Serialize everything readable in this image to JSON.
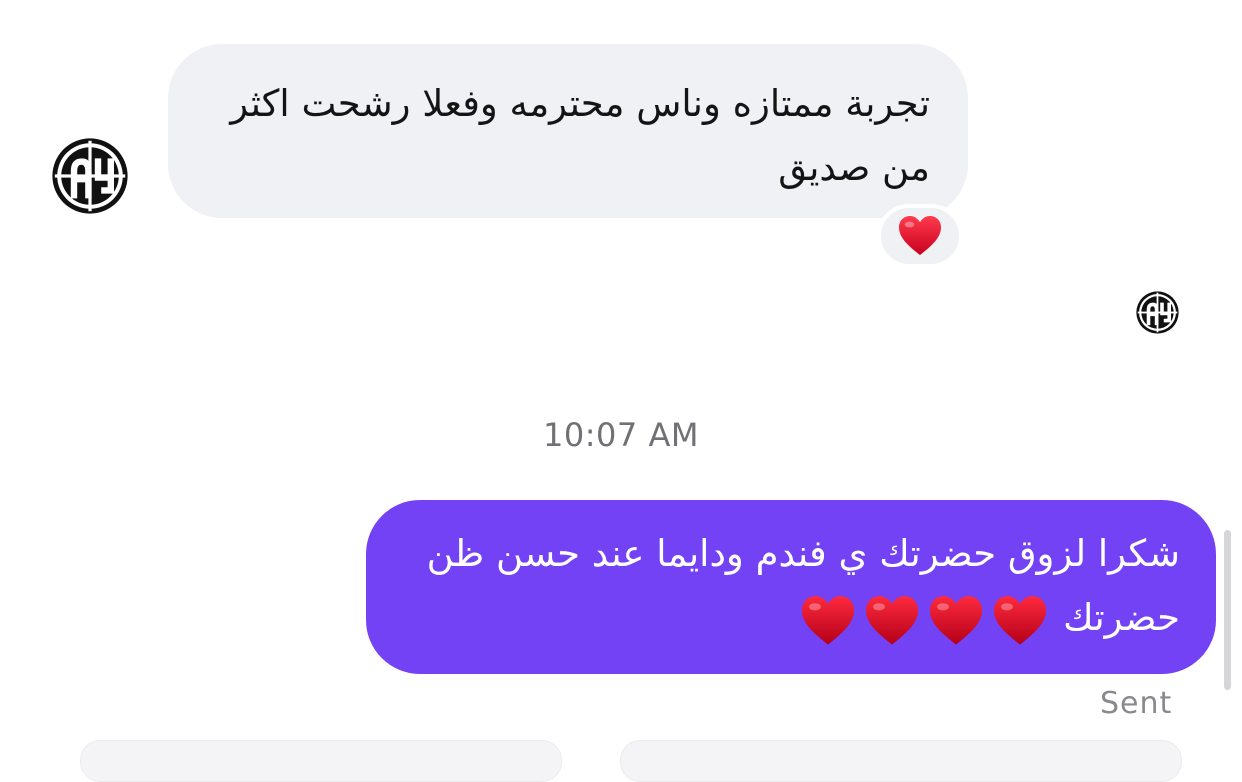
{
  "conversation": {
    "incoming": {
      "text": "تجربة ممتازه وناس محترمه وفعلا رشحت اكثر من صديق",
      "reaction": "❤️"
    },
    "timestamp": "10:07 AM",
    "outgoing": {
      "text": "شكرا لزوق حضرتك ي فندم ودايما عند حسن ظن حضرتك",
      "hearts": [
        "❤️",
        "❤️",
        "❤️",
        "❤️"
      ]
    },
    "status": "Sent"
  },
  "colors": {
    "incoming_bubble": "#f0f1f5",
    "outgoing_bubble": "#7442f5",
    "heart": "#e0102a"
  },
  "icons": {
    "contact_avatar": "ay-logo-avatar",
    "read_receipt": "ay-logo-avatar-small",
    "reaction": "red-heart-icon"
  }
}
